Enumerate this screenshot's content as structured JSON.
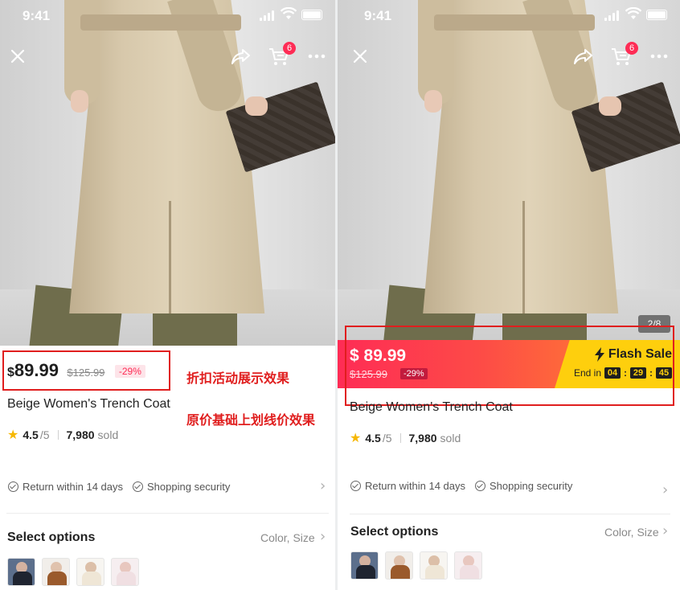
{
  "status_bar": {
    "time": "9:41"
  },
  "cart": {
    "badge_count": "6"
  },
  "left": {
    "price": {
      "currency": "$",
      "amount": "89.99",
      "original": "$125.99",
      "discount": "-29%"
    },
    "annotations": {
      "line1": "折扣活动展示效果",
      "line2": "原价基础上划线价效果"
    },
    "title": "Beige Women's Trench Coat",
    "rating": {
      "value": "4.5",
      "out_of": "/5",
      "sold_count": "7,980",
      "sold_label": "sold"
    },
    "services": {
      "return": "Return within 14 days",
      "security": "Shopping security"
    },
    "select": {
      "title": "Select options",
      "meta": "Color, Size"
    }
  },
  "right": {
    "image_counter": "2/8",
    "flash": {
      "price": "$ 89.99",
      "original": "$125.99",
      "discount": "-29%",
      "label": "Flash Sale",
      "ends_label": "End in",
      "hours": "04",
      "minutes": "29",
      "seconds": "45"
    },
    "title": "Beige Women's Trench Coat",
    "rating": {
      "value": "4.5",
      "out_of": "/5",
      "sold_count": "7,980",
      "sold_label": "sold"
    },
    "services": {
      "return": "Return within 14 days",
      "security": "Shopping security"
    },
    "select": {
      "title": "Select options",
      "meta": "Color, Size"
    }
  },
  "colors": {
    "accent": "#fe2c55",
    "flash_yellow": "#fecf0d",
    "annotation_red": "#e01e1e",
    "star": "#f6b700"
  },
  "icons": [
    "close-icon",
    "share-icon",
    "cart-icon",
    "more-icon",
    "star-icon",
    "check-circle-icon",
    "chevron-right-icon",
    "lightning-icon"
  ]
}
